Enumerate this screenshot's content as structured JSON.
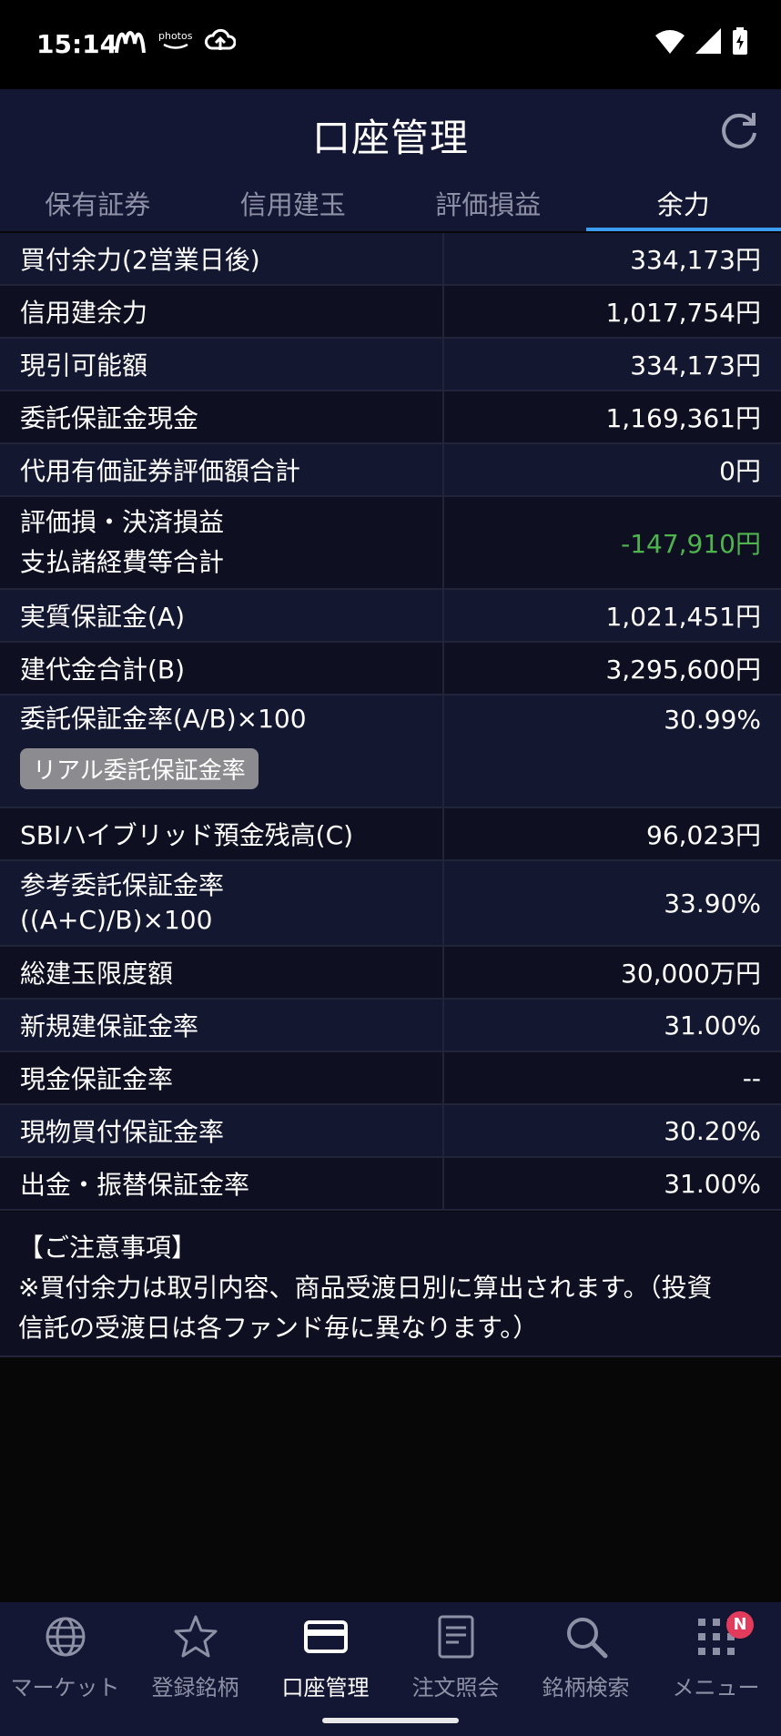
{
  "status": {
    "time": "15:14",
    "photos_label": "photos"
  },
  "header": {
    "title": "口座管理"
  },
  "tabs": [
    {
      "label": "保有証券"
    },
    {
      "label": "信用建玉"
    },
    {
      "label": "評価損益"
    },
    {
      "label": "余力"
    }
  ],
  "rows": [
    {
      "label": "買付余力(2営業日後)",
      "value": "334,173円"
    },
    {
      "label": "信用建余力",
      "value": "1,017,754円"
    },
    {
      "label": "現引可能額",
      "value": "334,173円"
    },
    {
      "label": "委託保証金現金",
      "value": "1,169,361円"
    },
    {
      "label": "代用有価証券評価額合計",
      "value": "0円"
    },
    {
      "label_line1": "評価損・決済損益",
      "label_line2": "支払諸経費等合計",
      "value": "-147,910円"
    },
    {
      "label": "実質保証金(A)",
      "value": "1,021,451円"
    },
    {
      "label": "建代金合計(B)",
      "value": "3,295,600円"
    },
    {
      "label": "委託保証金率(A/B)×100",
      "value": "30.99%",
      "button": "リアル委託保証金率"
    },
    {
      "label": "SBIハイブリッド預金残高(C)",
      "value": "96,023円"
    },
    {
      "label_line1": "参考委託保証金率",
      "label_line2": "((A+C)/B)×100",
      "value": "33.90%"
    },
    {
      "label": "総建玉限度額",
      "value": "30,000万円"
    },
    {
      "label": "新規建保証金率",
      "value": "31.00%"
    },
    {
      "label": "現金保証金率",
      "value": "--"
    },
    {
      "label": "現物買付保証金率",
      "value": "30.20%"
    },
    {
      "label": "出金・振替保証金率",
      "value": "31.00%"
    }
  ],
  "notes": {
    "title": "【ご注意事項】",
    "line1": "※買付余力は取引内容、商品受渡日別に算出されます。（投資",
    "line2": "信託の受渡日は各ファンド毎に異なります。）"
  },
  "nav": [
    {
      "label": "マーケット"
    },
    {
      "label": "登録銘柄"
    },
    {
      "label": "口座管理"
    },
    {
      "label": "注文照会"
    },
    {
      "label": "銘柄検索"
    },
    {
      "label": "メニュー",
      "badge": "N"
    }
  ],
  "colors": {
    "accent": "#3b9cf2",
    "negative": "#4fb34e",
    "badge": "#e33b5b"
  }
}
